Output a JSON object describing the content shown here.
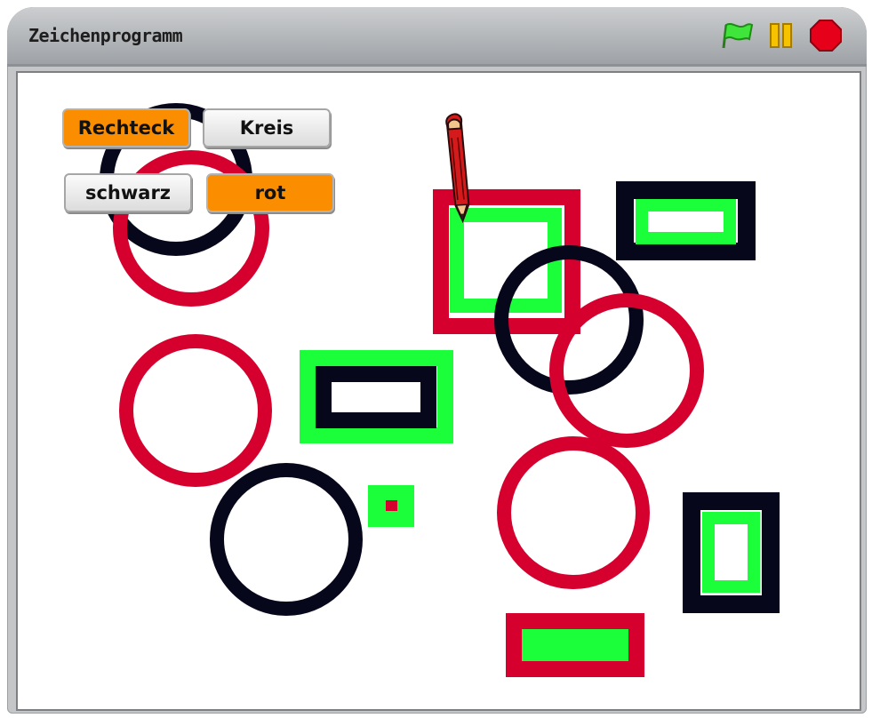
{
  "window": {
    "title": "Zeichenprogramm",
    "controls": {
      "green_flag": "green-flag-icon",
      "pause": "pause-icon",
      "stop": "stop-icon"
    }
  },
  "buttons": {
    "rechteck": "Rechteck",
    "kreis": "Kreis",
    "schwarz": "schwarz",
    "rot": "rot"
  },
  "colors": {
    "red": "#d5002e",
    "black": "#07071c",
    "green": "#1aff3a",
    "orange": "#fa8e00"
  },
  "sprite": "pencil-icon"
}
